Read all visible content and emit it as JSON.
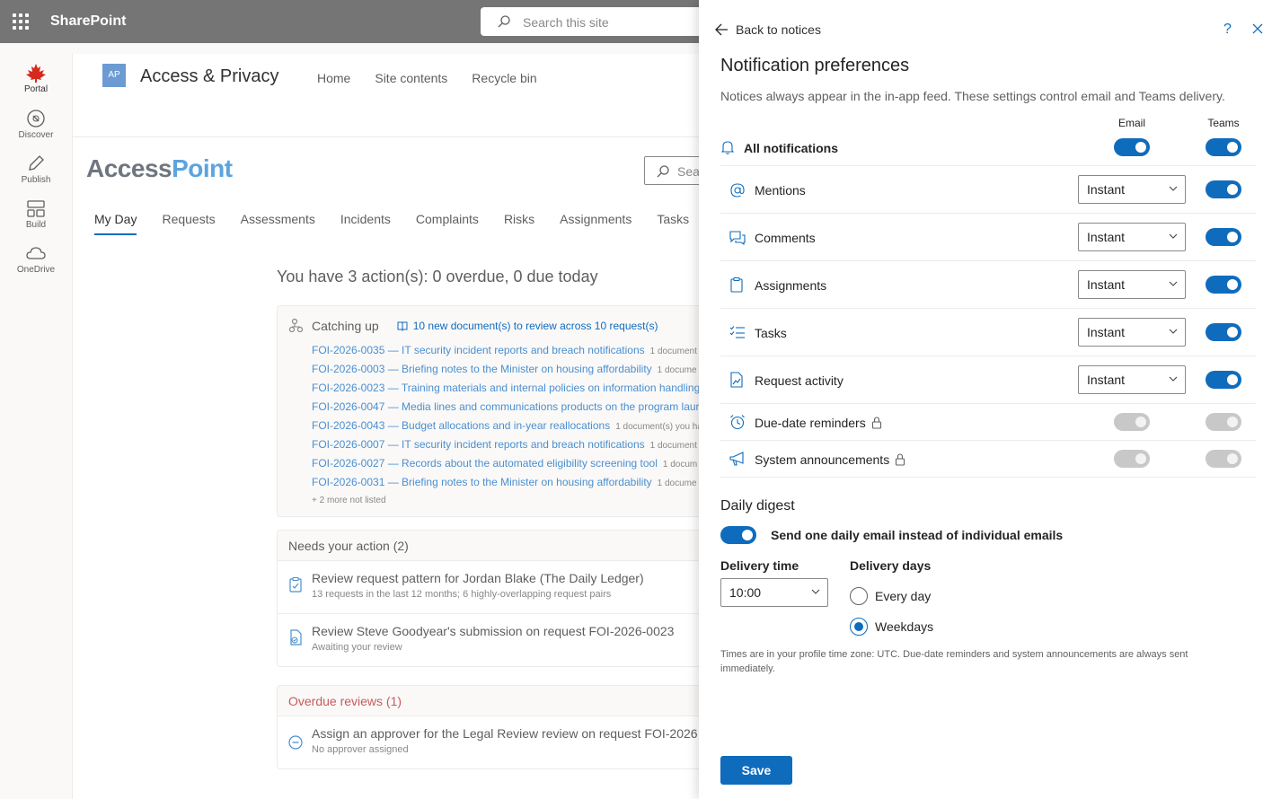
{
  "suite": {
    "title": "SharePoint",
    "search_placeholder": "Search this site"
  },
  "rail": [
    {
      "label": "Portal",
      "icon": "maple-leaf-icon"
    },
    {
      "label": "Discover",
      "icon": "compass-icon"
    },
    {
      "label": "Publish",
      "icon": "pen-icon"
    },
    {
      "label": "Build",
      "icon": "build-icon"
    },
    {
      "label": "OneDrive",
      "icon": "cloud-icon"
    }
  ],
  "site": {
    "logo": "AP",
    "name": "Access & Privacy",
    "nav": [
      "Home",
      "Site contents",
      "Recycle bin"
    ],
    "brand_a": "Access",
    "brand_b": "Point",
    "search_placeholder": "Sear",
    "tabs": [
      "My Day",
      "Requests",
      "Assessments",
      "Incidents",
      "Complaints",
      "Risks",
      "Assignments",
      "Tasks"
    ],
    "summary": "You have 3 action(s): 0 overdue, 0 due today"
  },
  "catching_up": {
    "title": "Catching up",
    "link": "10 new document(s) to review across 10 request(s)",
    "items": [
      {
        "text": "FOI-2026-0035 — IT security incident reports and breach notifications",
        "meta": "1 document"
      },
      {
        "text": "FOI-2026-0003 — Briefing notes to the Minister on housing affordability",
        "meta": "1 docume"
      },
      {
        "text": "FOI-2026-0023 — Training materials and internal policies on information handling",
        "meta": ""
      },
      {
        "text": "FOI-2026-0047 — Media lines and communications products on the program laur",
        "meta": ""
      },
      {
        "text": "FOI-2026-0043 — Budget allocations and in-year reallocations",
        "meta": "1 document(s) you ha"
      },
      {
        "text": "FOI-2026-0007 — IT security incident reports and breach notifications",
        "meta": "1 document"
      },
      {
        "text": "FOI-2026-0027 — Records about the automated eligibility screening tool",
        "meta": "1 docum"
      },
      {
        "text": "FOI-2026-0031 — Briefing notes to the Minister on housing affordability",
        "meta": "1 docume"
      }
    ],
    "more": "+ 2 more not listed"
  },
  "needs_action": {
    "title": "Needs your action (2)",
    "items": [
      {
        "title": "Review request pattern for Jordan Blake (The Daily Ledger)",
        "sub": "13 requests in the last 12 months; 6 highly-overlapping request pairs"
      },
      {
        "title": "Review Steve Goodyear's submission on request FOI-2026-0023",
        "sub": "Awaiting your review"
      }
    ]
  },
  "overdue": {
    "title": "Overdue reviews (1)",
    "items": [
      {
        "title": "Assign an approver for the Legal Review review on request FOI-2026",
        "sub": "No approver assigned"
      }
    ]
  },
  "panel": {
    "back_label": "Back to notices",
    "help": "?",
    "title": "Notification preferences",
    "description": "Notices always appear in the in-app feed. These settings control email and Teams delivery.",
    "col_email": "Email",
    "col_teams": "Teams",
    "all_label": "All notifications",
    "rows": [
      {
        "label": "Mentions",
        "frequency": "Instant",
        "teams": true,
        "icon": "at-icon"
      },
      {
        "label": "Comments",
        "frequency": "Instant",
        "teams": true,
        "icon": "comments-icon"
      },
      {
        "label": "Assignments",
        "frequency": "Instant",
        "teams": true,
        "icon": "clipboard-icon"
      },
      {
        "label": "Tasks",
        "frequency": "Instant",
        "teams": true,
        "icon": "task-list-icon"
      },
      {
        "label": "Request activity",
        "frequency": "Instant",
        "teams": true,
        "icon": "document-activity-icon"
      }
    ],
    "locked_rows": [
      {
        "label": "Due-date reminders",
        "icon": "alarm-icon"
      },
      {
        "label": "System announcements",
        "icon": "megaphone-icon"
      }
    ],
    "digest": {
      "title": "Daily digest",
      "toggle_label": "Send one daily email instead of individual emails",
      "enabled": true,
      "time_label": "Delivery time",
      "time_value": "10:00",
      "days_label": "Delivery days",
      "options": [
        "Every day",
        "Weekdays"
      ],
      "selected": "Weekdays"
    },
    "note": "Times are in your profile time zone: UTC. Due-date reminders and system announcements are always sent immediately.",
    "save_label": "Save"
  },
  "colors": {
    "accent": "#0f6cbd",
    "suitebar": "#757575",
    "overdue": "#c85a5a",
    "brand_point": "#5ba4e0"
  }
}
